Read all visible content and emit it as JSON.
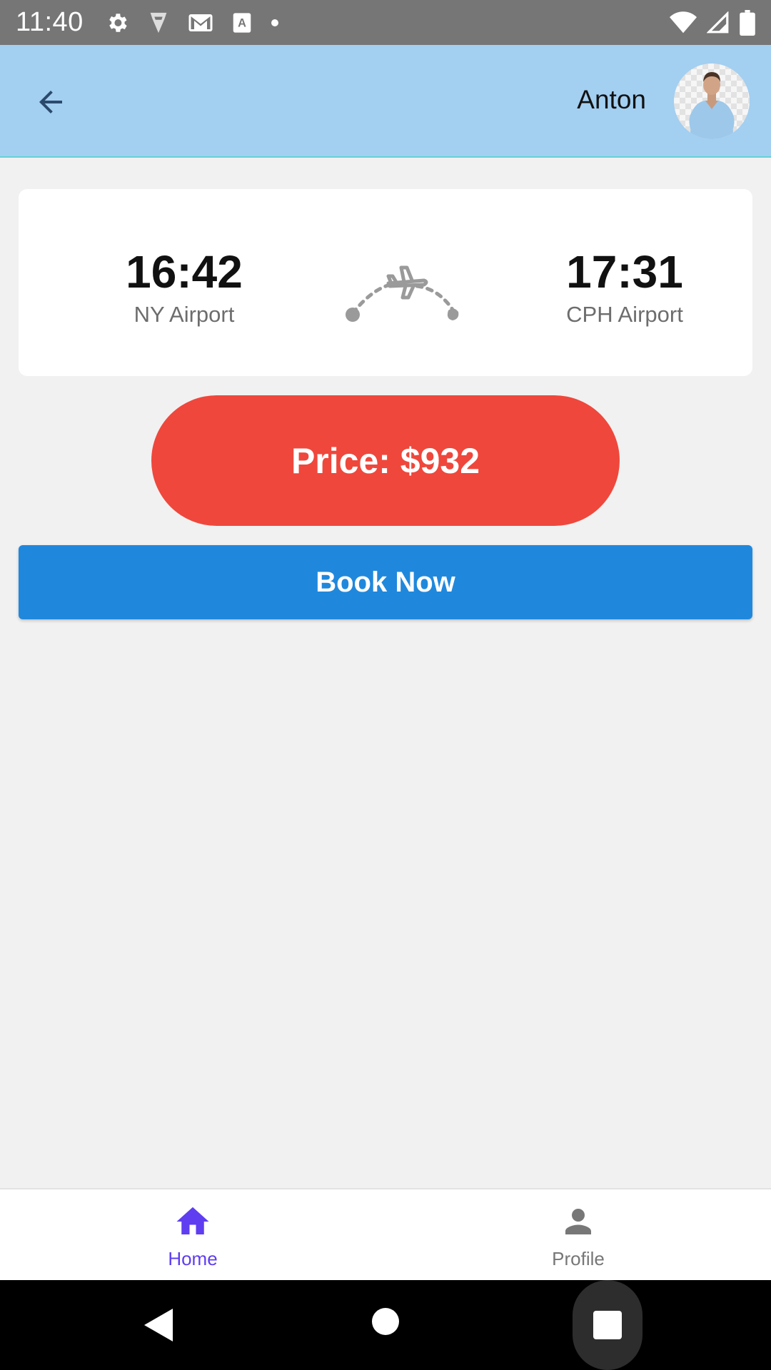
{
  "status_bar": {
    "time": "11:40",
    "icons": [
      "gear-icon",
      "shield-icon",
      "gmail-icon",
      "font-a-icon",
      "dot-icon",
      "wifi-icon",
      "signal-icon",
      "battery-icon"
    ]
  },
  "app_bar": {
    "back_icon": "arrow-left-icon",
    "user_name": "Anton",
    "avatar": "user-avatar"
  },
  "flight": {
    "departure_time": "16:42",
    "departure_airport": "NY Airport",
    "arrival_time": "17:31",
    "arrival_airport": "CPH Airport",
    "route_icon": "flight-route-icon"
  },
  "price_label": "Price: $932",
  "book_label": "Book Now",
  "bottom_nav": {
    "items": [
      {
        "label": "Home",
        "icon": "home-icon",
        "active": true
      },
      {
        "label": "Profile",
        "icon": "person-icon",
        "active": false
      }
    ]
  },
  "colors": {
    "app_bar": "#a3cff1",
    "price": "#ef473c",
    "book": "#2088dc",
    "nav_active": "#5f3df0"
  }
}
